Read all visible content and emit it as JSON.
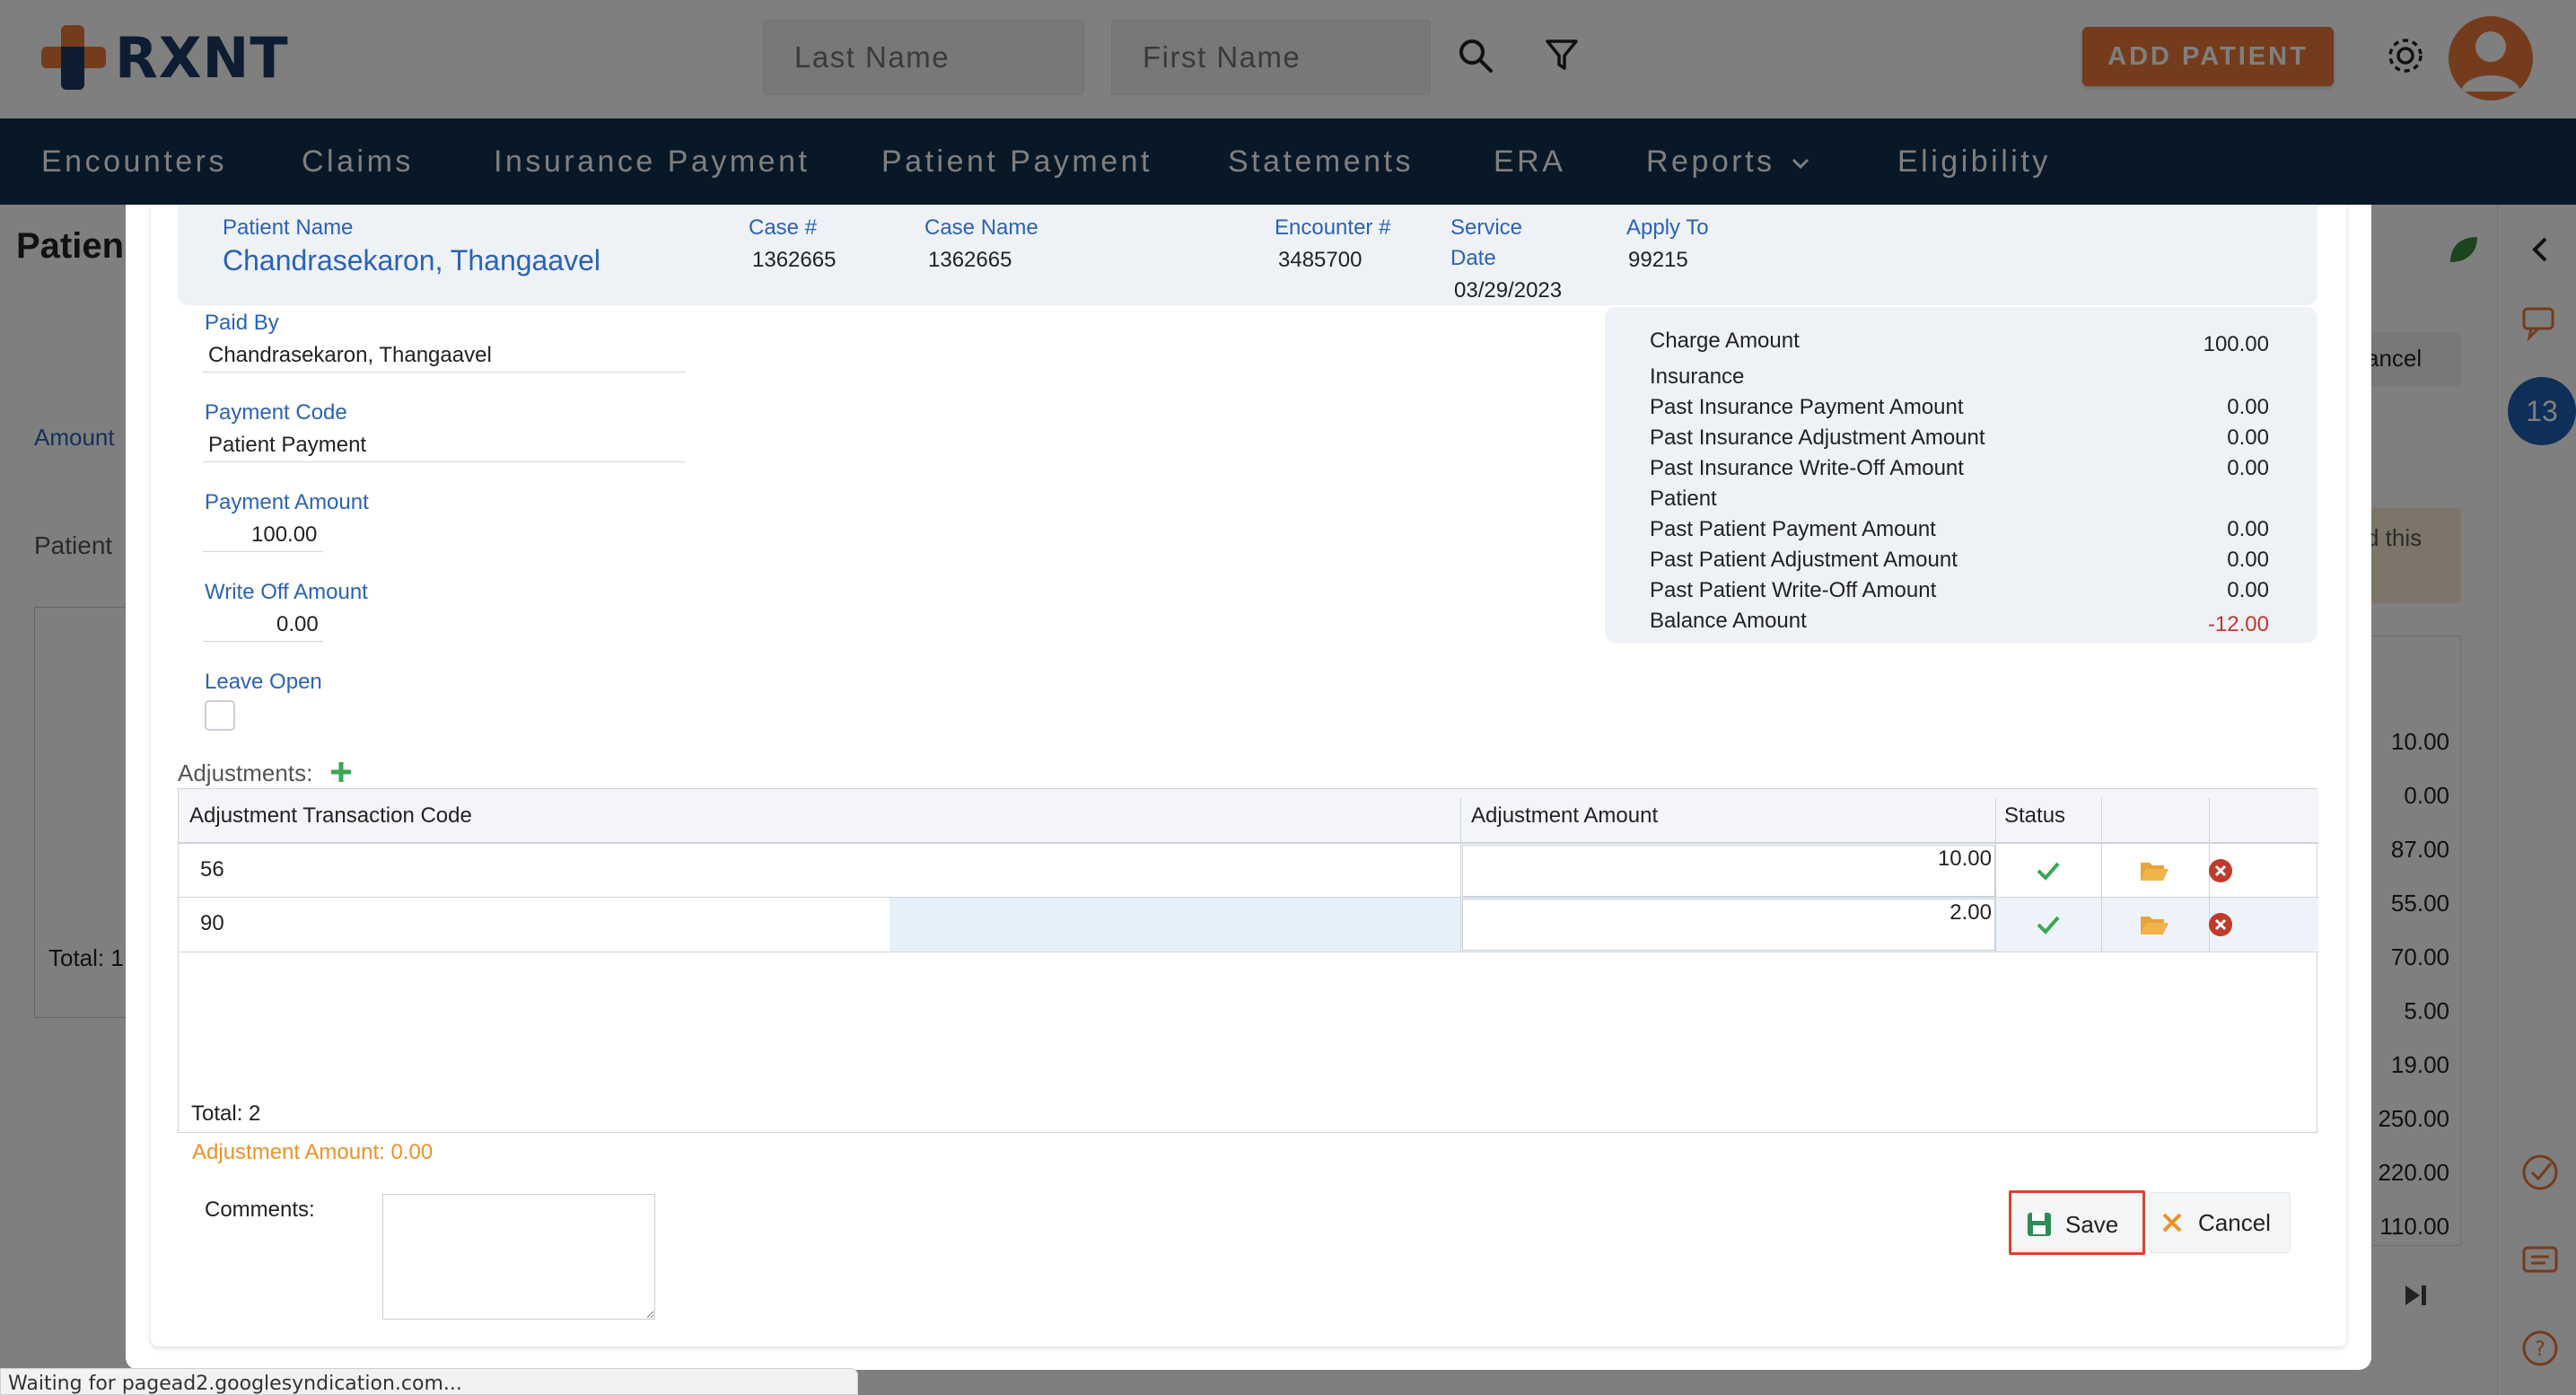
{
  "header": {
    "logo_text": "RXNT",
    "last_name_placeholder": "Last Name",
    "first_name_placeholder": "First Name",
    "add_patient_label": "ADD PATIENT"
  },
  "nav": {
    "items": [
      "Encounters",
      "Claims",
      "Insurance Payment",
      "Patient Payment",
      "Statements",
      "ERA",
      "Reports",
      "Eligibility"
    ]
  },
  "background": {
    "title": "Patien",
    "amount_label": "Amount",
    "patient_label": "Patient",
    "total_label": "Total: 1",
    "cancel_label": "ancel",
    "notice_text": "d this",
    "values": [
      "10.00",
      "0.00",
      "87.00",
      "55.00",
      "70.00",
      "5.00",
      "19.00",
      "250.00",
      "220.00",
      "110.00"
    ],
    "badge_count": "13"
  },
  "modal": {
    "info": {
      "patient_name_label": "Patient Name",
      "patient_name": "Chandrasekaron, Thangaavel",
      "case_no_label": "Case #",
      "case_no": "1362665",
      "case_name_label": "Case Name",
      "case_name": "1362665",
      "encounter_label": "Encounter #",
      "encounter": "3485700",
      "service_date_label_1": "Service",
      "service_date_label_2": "Date",
      "service_date": "03/29/2023",
      "apply_to_label": "Apply To",
      "apply_to": "99215"
    },
    "form": {
      "paid_by_label": "Paid By",
      "paid_by": "Chandrasekaron, Thangaavel",
      "payment_code_label": "Payment Code",
      "payment_code": "Patient Payment",
      "payment_amount_label": "Payment Amount",
      "payment_amount": "100.00",
      "write_off_label": "Write Off Amount",
      "write_off": "0.00",
      "leave_open_label": "Leave Open"
    },
    "summary": {
      "charge_amount_label": "Charge Amount",
      "charge_amount": "100.00",
      "insurance_heading": "Insurance",
      "past_ins_payment_label": "Past Insurance Payment Amount",
      "past_ins_payment": "0.00",
      "past_ins_adjustment_label": "Past Insurance Adjustment Amount",
      "past_ins_adjustment": "0.00",
      "past_ins_writeoff_label": "Past Insurance Write-Off Amount",
      "past_ins_writeoff": "0.00",
      "patient_heading": "Patient",
      "past_pat_payment_label": "Past Patient Payment Amount",
      "past_pat_payment": "0.00",
      "past_pat_adjustment_label": "Past Patient Adjustment Amount",
      "past_pat_adjustment": "0.00",
      "past_pat_writeoff_label": "Past Patient Write-Off Amount",
      "past_pat_writeoff": "0.00",
      "balance_label": "Balance Amount",
      "balance": "-12.00",
      "balance_color": "#c0392b"
    },
    "adjustments": {
      "label": "Adjustments:",
      "columns": [
        "Adjustment Transaction Code",
        "Adjustment Amount",
        "Status"
      ],
      "rows": [
        {
          "code": "56",
          "amount": "10.00"
        },
        {
          "code": "90",
          "amount": "2.00"
        }
      ],
      "total": "Total: 2",
      "adjustment_amount_summary": "Adjustment Amount: 0.00"
    },
    "comments_label": "Comments:",
    "save_label": "Save",
    "cancel_label": "Cancel"
  },
  "statusbar": "Waiting for pagead2.googlesyndication.com...",
  "colors": {
    "brand_orange": "#e8793a",
    "nav_navy": "#13304f",
    "link_blue": "#2b63b4",
    "success_green": "#3aa655",
    "folder_orange": "#e8a33a",
    "delete_red": "#c0392b",
    "focus_red": "#d9442f"
  }
}
